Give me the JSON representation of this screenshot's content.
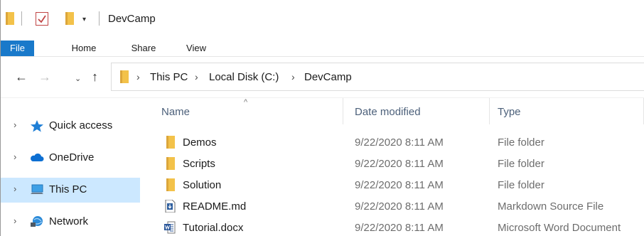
{
  "window": {
    "title": "DevCamp"
  },
  "quick_access_toolbar": {
    "icons": [
      "folder-icon",
      "properties-checkmark-icon",
      "new-folder-icon",
      "customize-dropdown-icon"
    ],
    "dropdown_glyph": "▾"
  },
  "ribbon": {
    "tabs": [
      {
        "label": "File"
      },
      {
        "label": "Home"
      },
      {
        "label": "Share"
      },
      {
        "label": "View"
      }
    ]
  },
  "navigation": {
    "back_glyph": "←",
    "forward_glyph": "→",
    "recent_glyph": "⌄",
    "up_glyph": "↑",
    "breadcrumb_separator": "›",
    "breadcrumb": [
      "This PC",
      "Local Disk (C:)",
      "DevCamp"
    ]
  },
  "nav_pane": {
    "expand_glyph": "›",
    "items": [
      {
        "label": "Quick access",
        "icon": "star-icon",
        "selected": false
      },
      {
        "label": "OneDrive",
        "icon": "cloud-icon",
        "selected": false
      },
      {
        "label": "This PC",
        "icon": "computer-icon",
        "selected": true
      },
      {
        "label": "Network",
        "icon": "network-icon",
        "selected": false
      }
    ]
  },
  "file_list": {
    "sort_glyph": "^",
    "columns": {
      "name": "Name",
      "date": "Date modified",
      "type": "Type"
    },
    "rows": [
      {
        "name": "Demos",
        "date": "9/22/2020 8:11 AM",
        "type": "File folder",
        "icon": "folder-icon"
      },
      {
        "name": "Scripts",
        "date": "9/22/2020 8:11 AM",
        "type": "File folder",
        "icon": "folder-icon"
      },
      {
        "name": "Solution",
        "date": "9/22/2020 8:11 AM",
        "type": "File folder",
        "icon": "folder-icon"
      },
      {
        "name": "README.md",
        "date": "9/22/2020 8:11 AM",
        "type": "Markdown Source File",
        "icon": "markdown-file-icon"
      },
      {
        "name": "Tutorial.docx",
        "date": "9/22/2020 8:11 AM",
        "type": "Microsoft Word Document",
        "icon": "word-document-icon"
      }
    ]
  },
  "colors": {
    "file_tab": "#1979ca",
    "selection": "#cce8ff",
    "folder": "#f3c24a",
    "column_header_text": "#4c607a",
    "secondary_text": "#6d6d6d"
  }
}
